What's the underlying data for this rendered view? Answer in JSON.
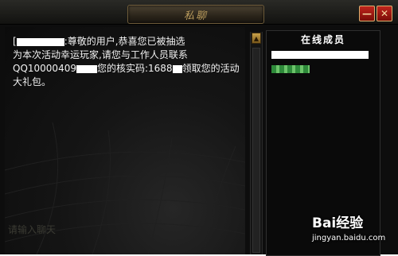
{
  "window": {
    "title": "私聊",
    "minimize_label": "—",
    "close_label": "✕"
  },
  "chat": {
    "message_prefix": "[",
    "message_line1": ":尊敬的用户,恭喜您已被抽选",
    "message_line2": "为本次活动幸运玩家,请您与工作人员联系",
    "message_line3_a": "QQ10000409",
    "message_line3_b": "您的核实码:1688",
    "message_line3_c": "领取您的活动",
    "message_line4": "大礼包。",
    "input_hint": "请输入聊天"
  },
  "members": {
    "header": "在线成员"
  },
  "watermark": {
    "logo": "Bai经验",
    "url": "jingyan.baidu.com"
  },
  "colors": {
    "frame_gold": "#b89a5c",
    "close_red": "#c0241c",
    "text": "#f2f2f2"
  },
  "icons": {
    "scroll_up": "triangle-up-icon",
    "paw": "paw-icon"
  }
}
